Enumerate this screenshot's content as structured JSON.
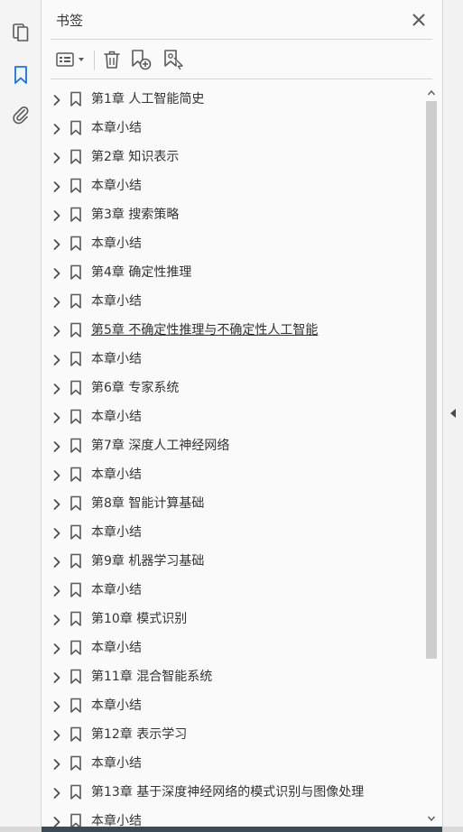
{
  "panel": {
    "title": "书签"
  },
  "rail": {
    "icons": [
      "pages-icon",
      "bookmarks-icon",
      "attachments-icon"
    ],
    "active": "bookmarks-icon"
  },
  "toolbar": {
    "icons": [
      "options-menu-icon",
      "delete-bookmark-icon",
      "new-bookmark-icon",
      "new-bookmark-from-structure-icon"
    ]
  },
  "colors": {
    "accent": "#1473e6",
    "text": "#333333",
    "icon": "#5a5a5a"
  },
  "bookmarks": [
    {
      "label": "第1章  人工智能简史"
    },
    {
      "label": "本章小结"
    },
    {
      "label": "第2章  知识表示"
    },
    {
      "label": "本章小结"
    },
    {
      "label": "第3章  搜索策略"
    },
    {
      "label": "本章小结"
    },
    {
      "label": "第4章  确定性推理"
    },
    {
      "label": "本章小结"
    },
    {
      "label": "第5章  不确定性推理与不确定性人工智能",
      "active": true
    },
    {
      "label": "本章小结"
    },
    {
      "label": "第6章  专家系统"
    },
    {
      "label": "本章小结"
    },
    {
      "label": "第7章  深度人工神经网络"
    },
    {
      "label": "本章小结"
    },
    {
      "label": "第8章  智能计算基础"
    },
    {
      "label": "本章小结"
    },
    {
      "label": "第9章  机器学习基础"
    },
    {
      "label": "本章小结"
    },
    {
      "label": "第10章  模式识别"
    },
    {
      "label": "本章小结"
    },
    {
      "label": "第11章  混合智能系统"
    },
    {
      "label": "本章小结"
    },
    {
      "label": "第12章  表示学习"
    },
    {
      "label": "本章小结"
    },
    {
      "label": "第13章  基于深度神经网络的模式识别与图像处理"
    },
    {
      "label": "本章小结"
    }
  ]
}
